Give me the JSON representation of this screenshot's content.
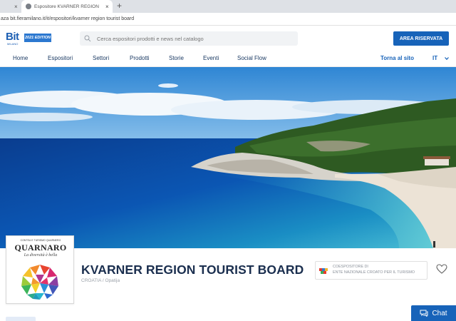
{
  "browser": {
    "inactive_tab_close": "×",
    "active_tab_title": "Espositore KVARNER REGION",
    "active_tab_close": "×",
    "new_tab": "+",
    "address": "aza bit.fieramilano.it/it/espositori/kvarner region tourist board"
  },
  "header": {
    "logo_text": "Bit",
    "logo_badge": "2021 EDITION",
    "logo_sub": "MILANO",
    "search_placeholder": "Cerca espositori prodotti e news nel catalogo",
    "area_button": "AREA RISERVATA"
  },
  "nav": {
    "items": [
      {
        "label": "Home"
      },
      {
        "label": "Espositori"
      },
      {
        "label": "Settori"
      },
      {
        "label": "Prodotti"
      },
      {
        "label": "Storie"
      },
      {
        "label": "Eventi"
      },
      {
        "label": "Social Flow"
      }
    ],
    "back_to_site": "Torna al sito",
    "language": "IT"
  },
  "exhibitor": {
    "logo_card_top": "CONTEA E TURISMO QUARNERO",
    "logo_card_brand": "QUARNARO",
    "logo_card_tagline": "La diversità è bella",
    "name": "KVARNER REGION TOURIST BOARD",
    "location": "CROATIA / Opatija",
    "coexhibitor_label": "COESPOSITORE DI",
    "coexhibitor_value": "ENTE NAZIONALE CROATO PER IL TURISMO"
  },
  "chat": {
    "label": "Chat"
  },
  "colors": {
    "brand_blue": "#1763b9",
    "nav_text": "#1b3a63",
    "title_text": "#1b2f4f"
  }
}
